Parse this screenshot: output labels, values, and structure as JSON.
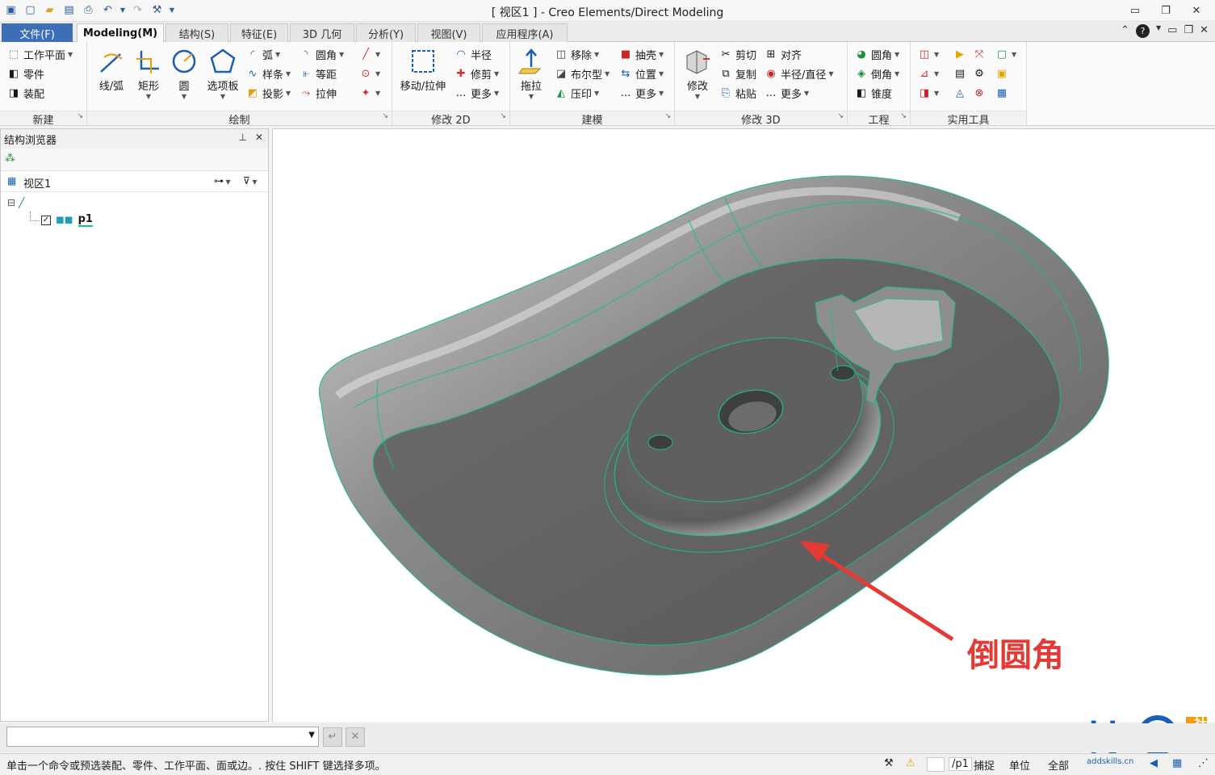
{
  "window": {
    "title": "[ 视区1 ] - Creo Elements/Direct Modeling"
  },
  "tabs": [
    {
      "label": "文件(F)"
    },
    {
      "label": "Modeling(M)"
    },
    {
      "label": "结构(S)"
    },
    {
      "label": "特征(E)"
    },
    {
      "label": "3D 几何"
    },
    {
      "label": "分析(Y)"
    },
    {
      "label": "视图(V)"
    },
    {
      "label": "应用程序(A)"
    }
  ],
  "ribbon": {
    "new": {
      "label": "新建",
      "workplane": "工作平面",
      "part": "零件",
      "assembly": "装配"
    },
    "draw": {
      "label": "绘制",
      "line_arc": "线/弧",
      "rect": "矩形",
      "circle": "圆",
      "palette": "选项板",
      "arc": "弧",
      "spline": "样条",
      "project": "投影",
      "fillet": "圆角",
      "offset": "等距",
      "stretch": "拉伸"
    },
    "modify2d": {
      "label": "修改 2D",
      "move_stretch": "移动/拉伸",
      "radius": "半径",
      "trim": "修剪",
      "more": "更多"
    },
    "model": {
      "label": "建模",
      "pull": "拖拉",
      "remove": "移除",
      "boolean": "布尔型",
      "imprint": "压印",
      "shell": "抽壳",
      "position": "位置",
      "more": "更多"
    },
    "modify3d": {
      "label": "修改 3D",
      "modify": "修改",
      "cut": "剪切",
      "copy": "复制",
      "paste": "粘贴",
      "align": "对齐",
      "radius_diameter": "半径/直径",
      "more": "更多"
    },
    "engineering": {
      "label": "工程",
      "round": "圆角",
      "chamfer": "倒角",
      "taper": "锥度"
    },
    "utilities": {
      "label": "实用工具"
    }
  },
  "browser": {
    "title": "结构浏览器",
    "view": "视区1",
    "part_name": "p1"
  },
  "viewport": {
    "annotation": "倒圆角",
    "watermark_text": "技",
    "watermark_side": "社区",
    "watermark_url": "addskills.cn"
  },
  "status": {
    "prompt": "单击一个命令或预选装配、零件、工作平面、面或边。. 按住 SHIFT 键选择多项。",
    "path": "/p1",
    "snap": "捕捉",
    "units": "单位",
    "all": "全部"
  },
  "colors": {
    "accent_blue": "#1a5fb4",
    "edge_green": "#19c07a",
    "arrow_red": "#e53935",
    "annotation_red": "#e53935"
  }
}
